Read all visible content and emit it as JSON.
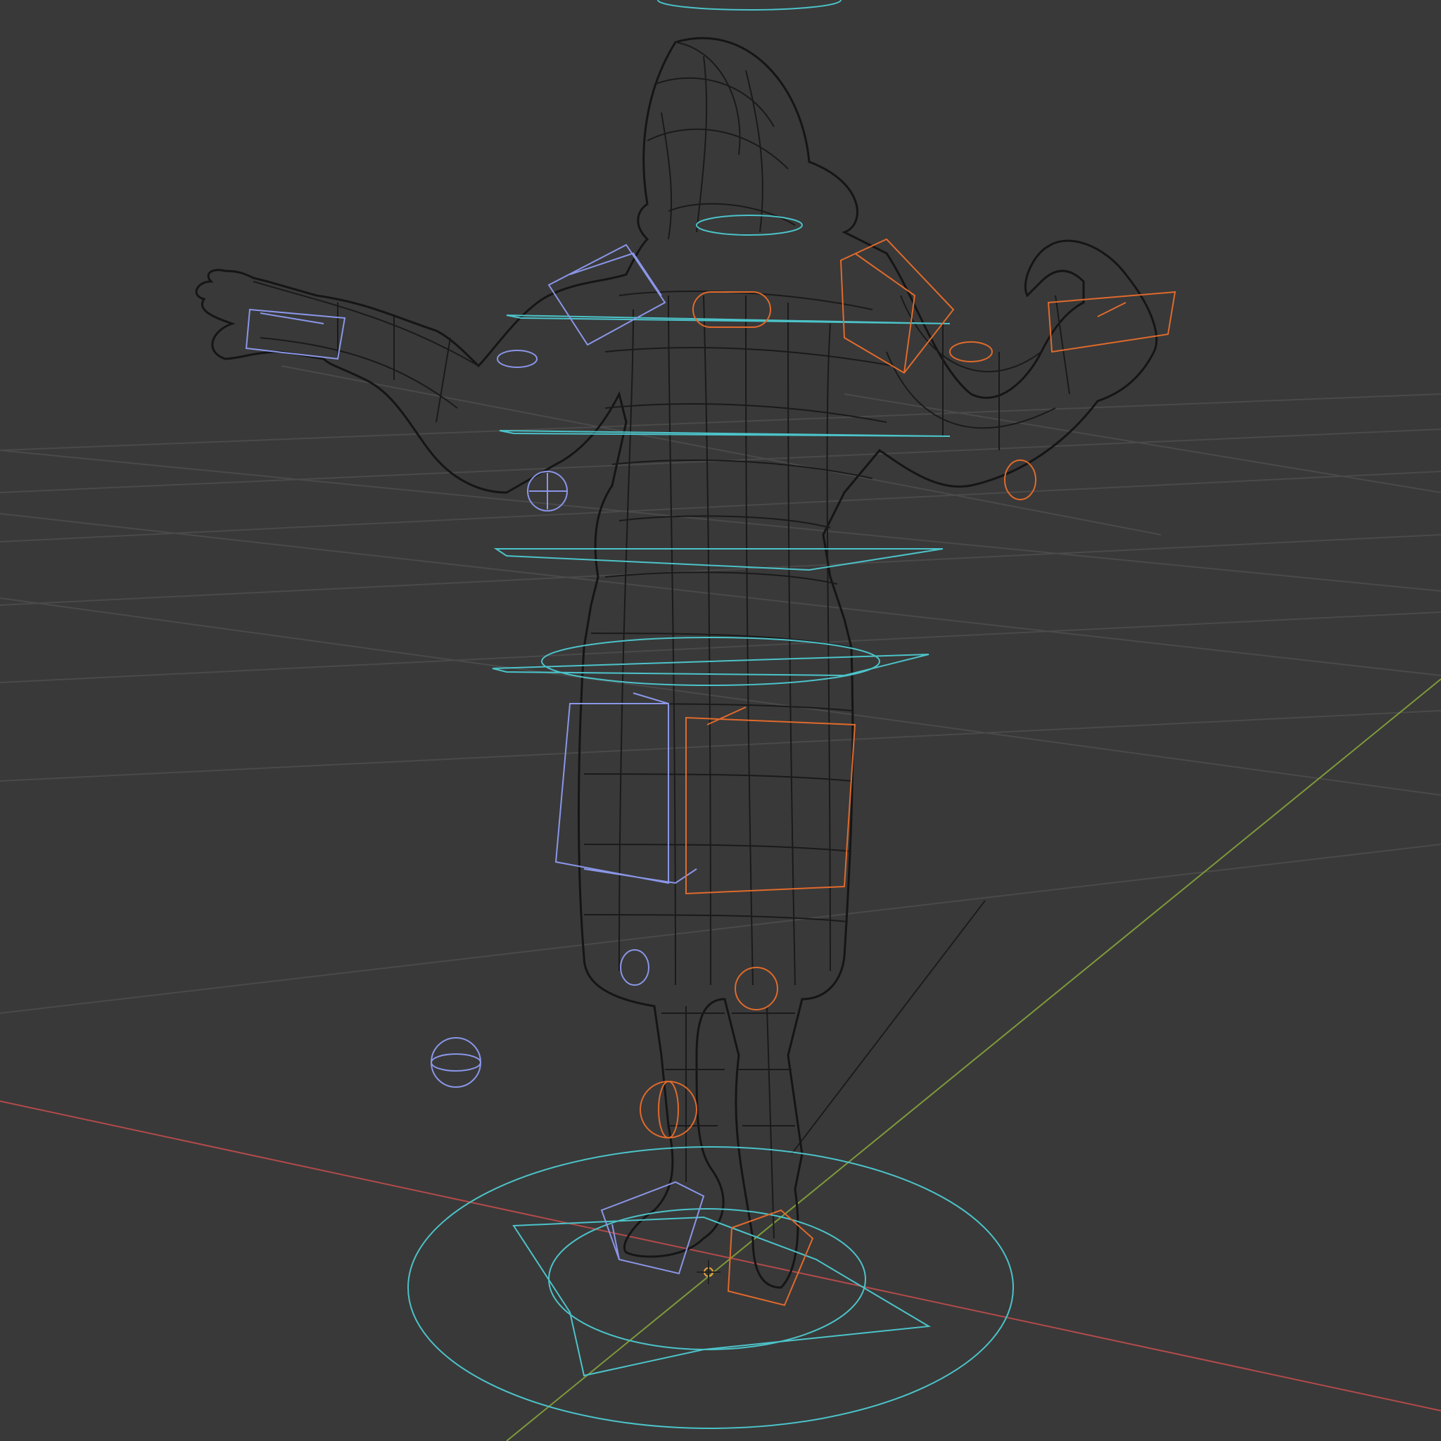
{
  "viewport": {
    "name": "3d-viewport",
    "background": "#393939"
  },
  "colors": {
    "grid": "#4a4a4a",
    "x_axis": "#b34a4a",
    "y_axis": "#7e9a3a",
    "mesh": "#151515",
    "mesh_fill": "#2b2b2b",
    "control_cyan": "#4cc3c9",
    "control_blue": "#8a96e8",
    "control_orange": "#e06a2c",
    "origin": "#e8a13a"
  },
  "scene": {
    "object": "character-wireframe-mesh",
    "rig": "armature-controls",
    "cursor": "3d-cursor-icon"
  }
}
